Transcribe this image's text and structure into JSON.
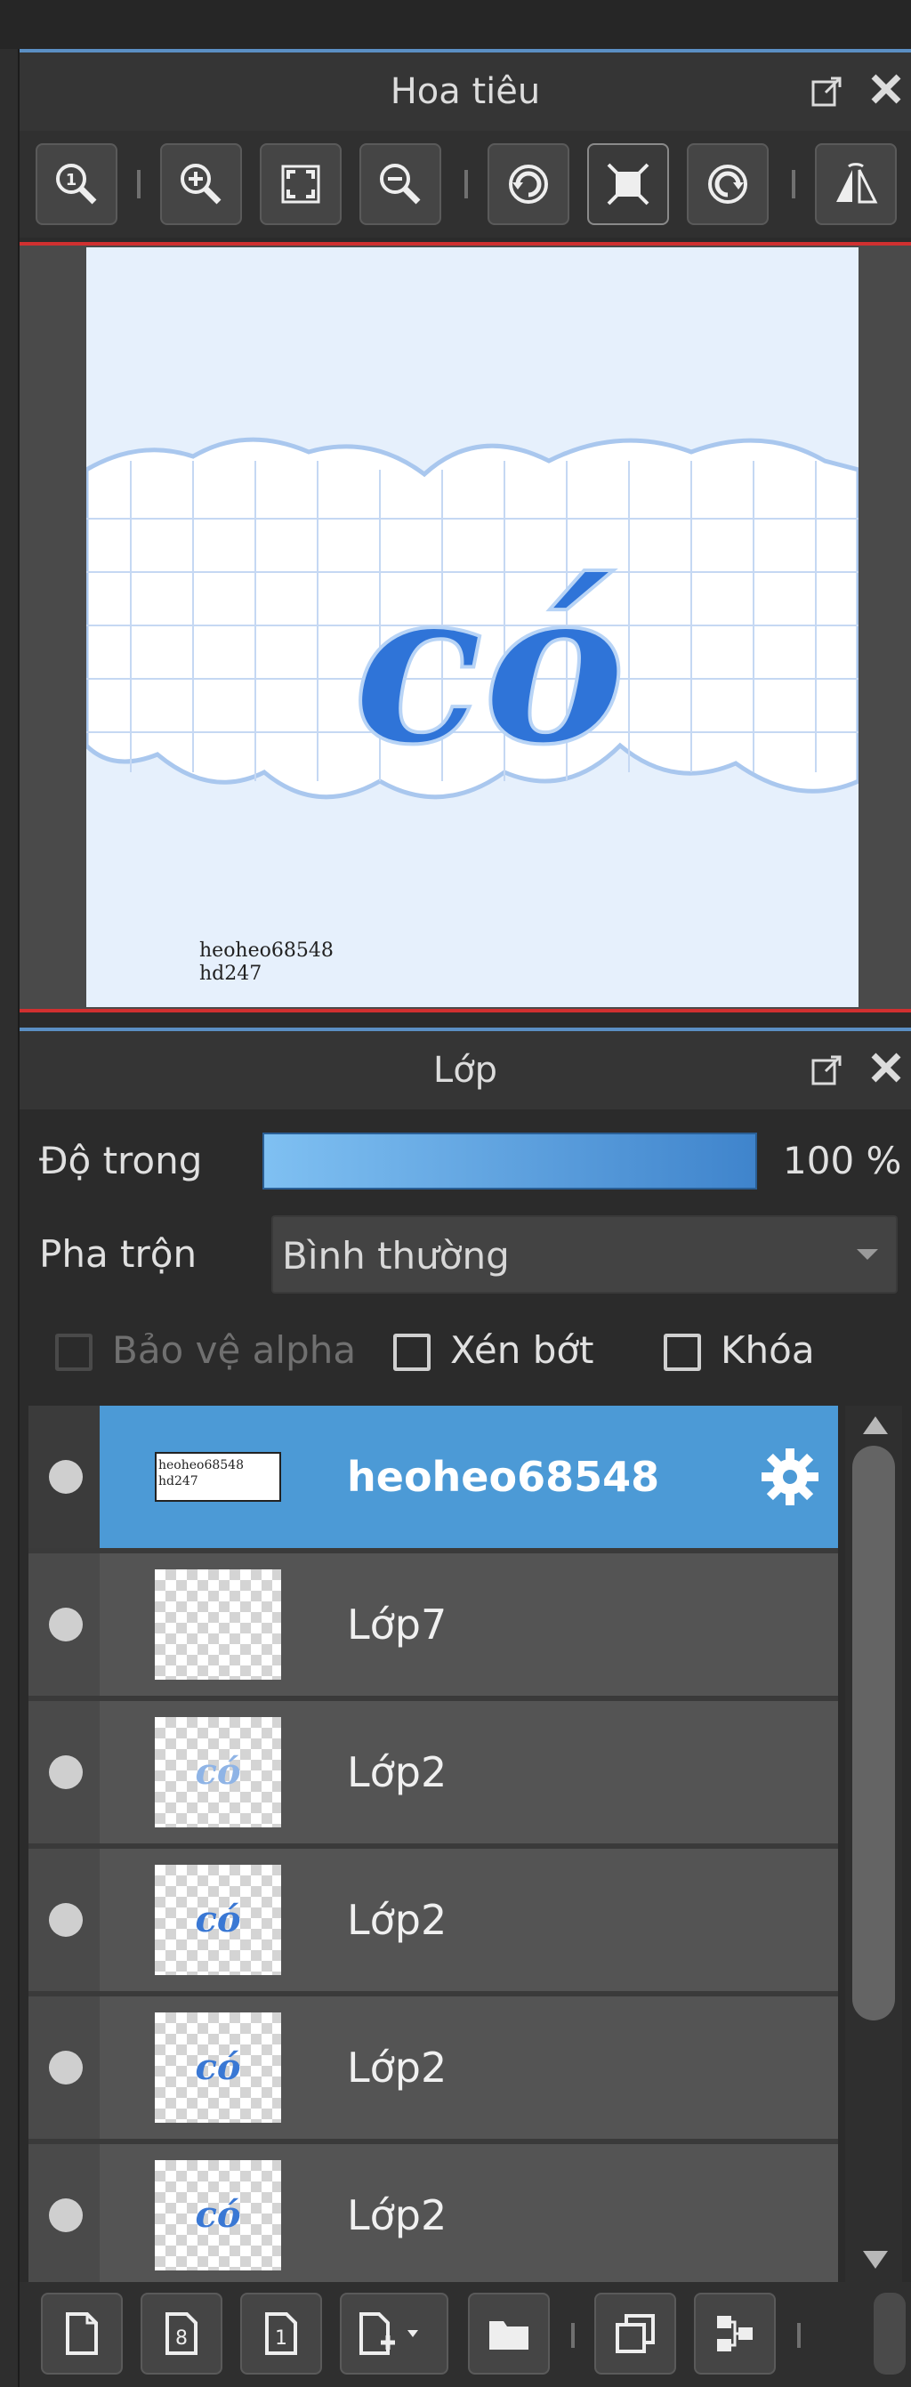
{
  "navigator": {
    "title": "Hoa tiêu",
    "popout_icon": "popout-icon",
    "close_icon": "close-icon",
    "toolbar_icons": [
      "zoom-actual-icon",
      "zoom-in-icon",
      "fit-screen-icon",
      "zoom-out-icon",
      "rotate-left-icon",
      "reset-view-icon",
      "rotate-right-icon",
      "flip-horizontal-icon"
    ],
    "canvas_credit": [
      "heoheo68548",
      "hd247"
    ]
  },
  "layers_panel": {
    "title": "Lớp",
    "opacity_label": "Độ trong",
    "opacity_value": "100 %",
    "opacity_percent": 100,
    "blend_label": "Pha trộn",
    "blend_value": "Bình thường",
    "checkboxes": [
      {
        "label": "Bảo vệ alpha",
        "checked": false,
        "enabled": false
      },
      {
        "label": "Xén bớt",
        "checked": false,
        "enabled": true
      },
      {
        "label": "Khóa",
        "checked": false,
        "enabled": true
      }
    ],
    "layers": [
      {
        "name": "heoheo68548",
        "selected": true,
        "thumb_text": "heoheo68548 hd247"
      },
      {
        "name": "Lớp7",
        "selected": false,
        "thumb_text": ""
      },
      {
        "name": "Lớp2",
        "selected": false,
        "thumb_text": "có"
      },
      {
        "name": "Lớp2",
        "selected": false,
        "thumb_text": "có"
      },
      {
        "name": "Lớp2",
        "selected": false,
        "thumb_text": "có"
      },
      {
        "name": "Lớp2",
        "selected": false,
        "thumb_text": "có"
      }
    ],
    "bottom_toolbar_icons": [
      "new-layer-icon",
      "new-8bit-layer-icon",
      "new-1bit-layer-icon",
      "add-layer-dropdown-icon",
      "folder-icon",
      "duplicate-layer-icon",
      "merge-layer-icon"
    ]
  },
  "colors": {
    "accent": "#4c9ad6",
    "panel_bg": "#2b2b2b",
    "row_bg": "#545454",
    "red_frame": "#d03030"
  }
}
